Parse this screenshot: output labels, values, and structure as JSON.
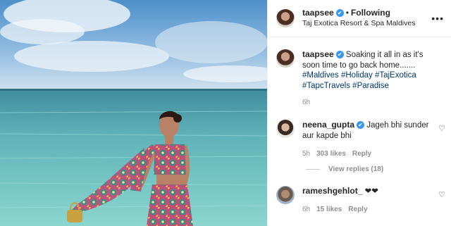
{
  "post": {
    "username": "taapsee",
    "follow_label": "Following",
    "location": "Taj Exotica Resort & Spa Maldives",
    "dot": "•",
    "more": "•••",
    "image_alt": "Woman in patterned outfit standing at sea shore"
  },
  "caption": {
    "username": "taapsee",
    "text": "Soaking it all in as it's soon time to go back home.......",
    "hashtags": [
      "#Maldives",
      "#Holiday",
      "#TajExotica",
      "#TapcTravels",
      "#Paradise"
    ],
    "time": "6h"
  },
  "comments": [
    {
      "username": "neena_gupta",
      "verified": true,
      "text": "Jageh bhi sunder aur kapde bhi",
      "time": "5h",
      "likes": "303 likes",
      "reply": "Reply",
      "view_replies": "View replies (18)"
    },
    {
      "username": "rameshgehlot_",
      "verified": false,
      "text": "❤❤",
      "time": "6h",
      "likes": "15 likes",
      "reply": "Reply"
    }
  ],
  "icons": {
    "verified": "✔",
    "heart": "♡"
  },
  "colors": {
    "link": "#00376b",
    "verified": "#3897f0",
    "muted": "#8e8e8e"
  }
}
